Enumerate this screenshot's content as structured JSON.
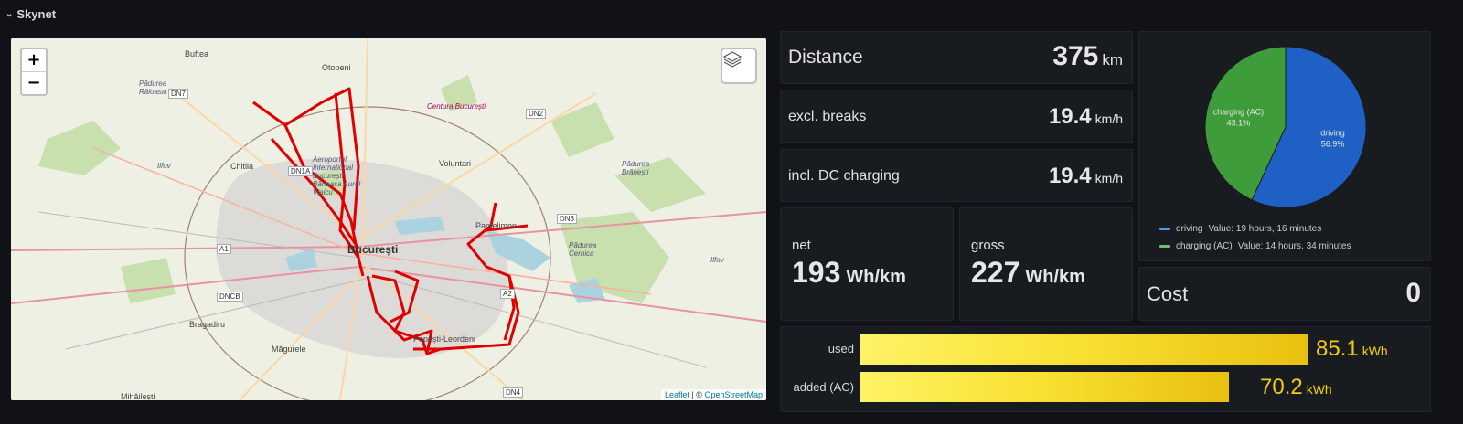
{
  "row": {
    "title": "Skynet"
  },
  "map": {
    "zoom_in": "+",
    "zoom_out": "−",
    "attribution_leaflet": "Leaflet",
    "attribution_sep": " | © ",
    "attribution_osm": "OpenStreetMap",
    "labels": {
      "buftea": "Buftea",
      "otopeni": "Otopeni",
      "padurea_raioasa": "Pădurea Râioasa",
      "chitila": "Chitila",
      "aeroport": "Aeroportul Internațional București-Băneasa Aurel Vlaicu",
      "centura": "Centura București",
      "voluntari": "Voluntari",
      "padurea_branesti": "Pădurea Brănești",
      "ilfov": "Ilfov",
      "pantelimon": "Pantelimon",
      "bucuresti": "București",
      "padurea_cernica": "Pădurea Cernica",
      "ilfov2": "Ilfov",
      "bragadiru": "Bragadiru",
      "magurele": "Măgurele",
      "berceni": "Popești-Leordeni",
      "mihailesti": "Mihăilești"
    },
    "roads": {
      "dn7": "DN7",
      "dn2": "DN2",
      "dn1a": "DN1A",
      "dn3": "DN3",
      "a1": "A1",
      "dncb": "DNCB",
      "a2": "A2",
      "dn4": "DN4"
    }
  },
  "stats": {
    "distance": {
      "label": "Distance",
      "value": "375",
      "unit": "km"
    },
    "excl_breaks": {
      "label": "excl. breaks",
      "value": "19.4",
      "unit": "km/h"
    },
    "incl_dc": {
      "label": "incl. DC charging",
      "value": "19.4",
      "unit": "km/h"
    },
    "net": {
      "label": "net",
      "value": "193",
      "unit": "Wh/km"
    },
    "gross": {
      "label": "gross",
      "value": "227",
      "unit": "Wh/km"
    },
    "cost": {
      "label": "Cost",
      "value": "0"
    }
  },
  "pie": {
    "slices": [
      {
        "name": "driving",
        "percent": 56.9,
        "pct_label": "56.9%",
        "color": "#1f60c4"
      },
      {
        "name": "charging (AC)",
        "percent": 43.1,
        "pct_label": "43.1%",
        "color": "#3f9c3a"
      }
    ],
    "legend": [
      {
        "name": "driving",
        "value_text": "Value: 19 hours, 16 minutes",
        "color": "#5794f2"
      },
      {
        "name": "charging (AC)",
        "value_text": "Value: 14 hours, 34 minutes",
        "color": "#73bf69"
      }
    ]
  },
  "energy": {
    "max": 85.1,
    "bars": [
      {
        "label": "used",
        "value": 85.1,
        "value_text": "85.1",
        "unit": "kWh"
      },
      {
        "label": "added (AC)",
        "value": 70.2,
        "value_text": "70.2",
        "unit": "kWh"
      }
    ],
    "color": "#f2cc0c"
  }
}
